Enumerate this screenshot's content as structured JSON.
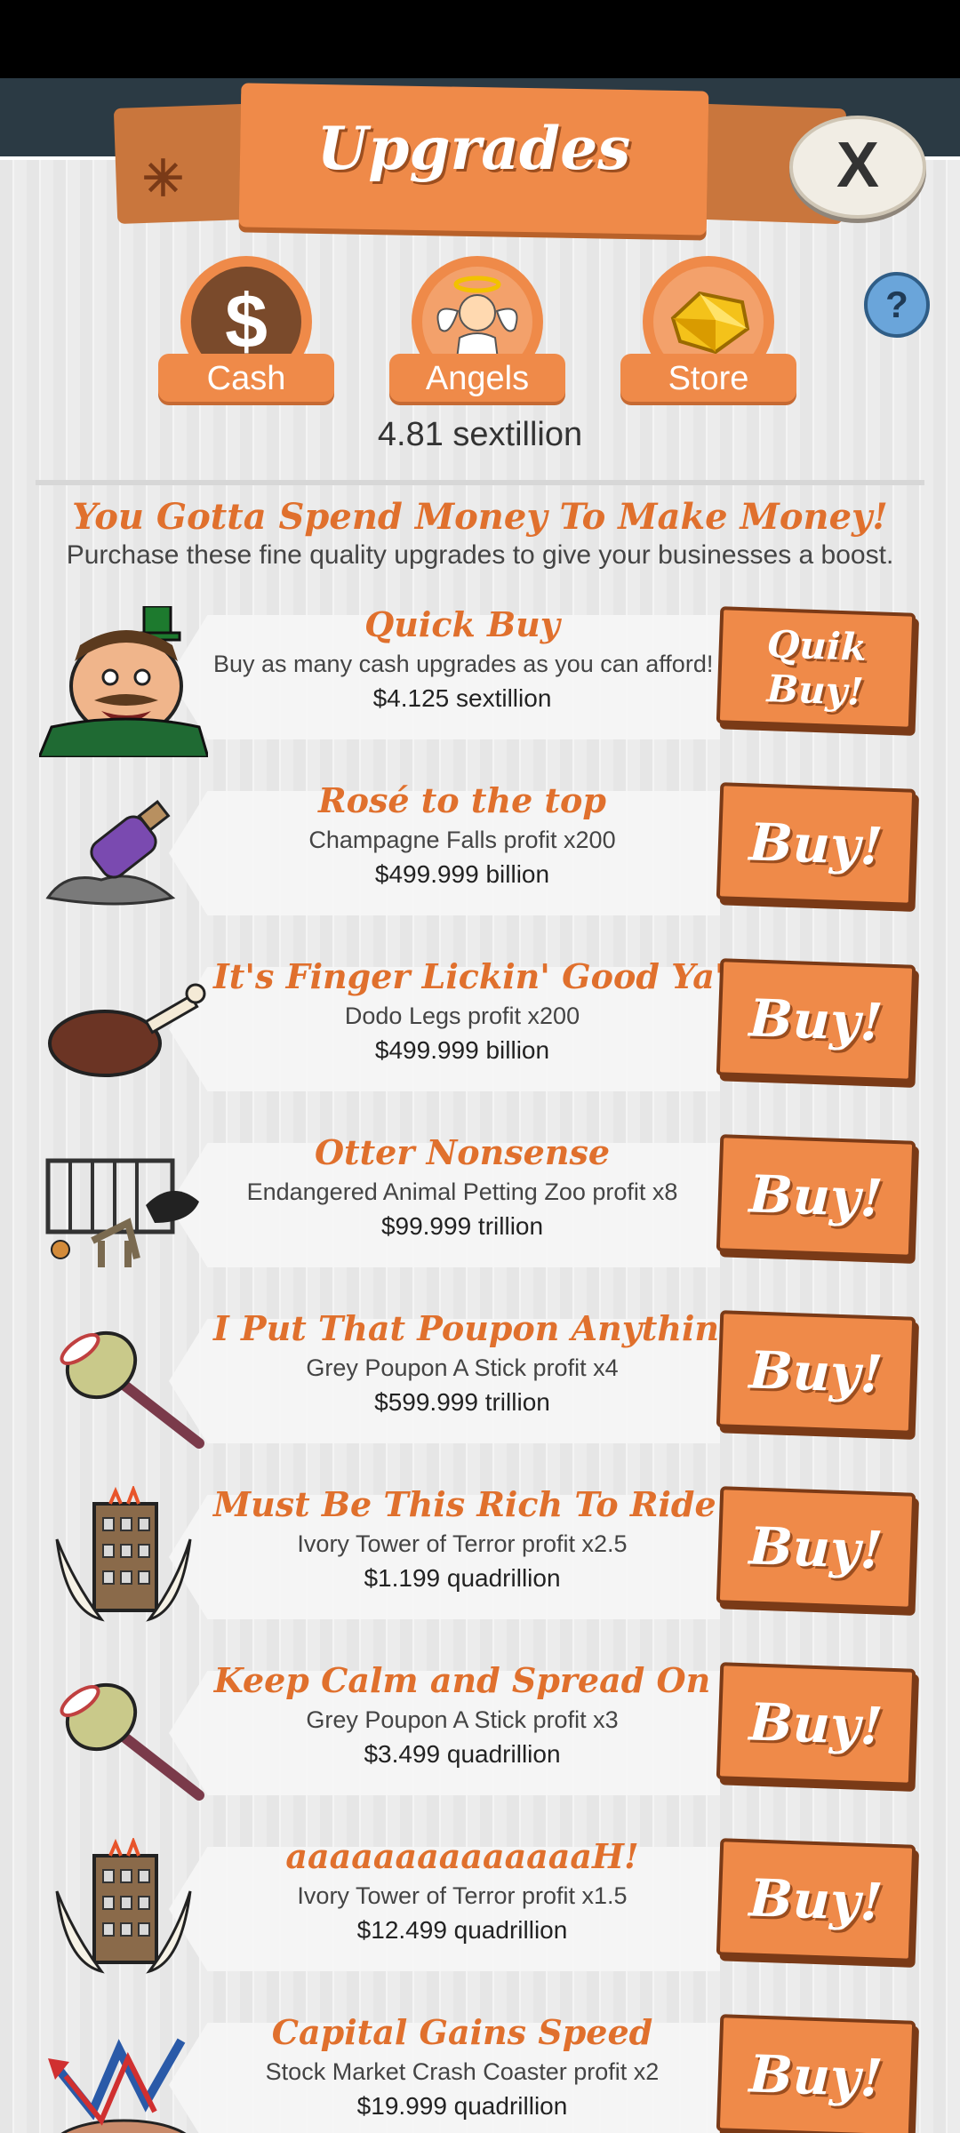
{
  "window": {
    "title": "Upgrades",
    "close_label": "X"
  },
  "tabs": [
    {
      "label": "Cash",
      "icon": "dollar-coin-icon"
    },
    {
      "label": "Angels",
      "icon": "angel-icon"
    },
    {
      "label": "Store",
      "icon": "gold-gem-icon"
    }
  ],
  "help_label": "?",
  "balance": "4.81 sextillion",
  "intro": {
    "headline": "You Gotta Spend Money To Make Money!",
    "subline": "Purchase these fine quality upgrades to give your businesses a boost."
  },
  "upgrades": [
    {
      "name": "Quick Buy",
      "desc": "Buy as many cash upgrades as you can afford!",
      "price": "$4.125 sextillion",
      "button": "Quik Buy!",
      "icon": "tycoon-icon"
    },
    {
      "name": "Rosé to the top",
      "desc": "Champagne Falls profit x200",
      "price": "$499.999 billion",
      "button": "Buy!",
      "icon": "bottle-icon"
    },
    {
      "name": "It's Finger Lickin' Good Ya'll",
      "desc": "Dodo Legs profit x200",
      "price": "$499.999 billion",
      "button": "Buy!",
      "icon": "drumstick-icon"
    },
    {
      "name": "Otter Nonsense",
      "desc": "Endangered Animal Petting Zoo profit x8",
      "price": "$99.999 trillion",
      "button": "Buy!",
      "icon": "zoo-cage-icon"
    },
    {
      "name": "I Put That Poupon Anything!",
      "desc": "Grey Poupon A Stick profit x4",
      "price": "$599.999 trillion",
      "button": "Buy!",
      "icon": "mustard-stick-icon"
    },
    {
      "name": "Must Be This Rich To Ride",
      "desc": "Ivory Tower of Terror profit x2.5",
      "price": "$1.199 quadrillion",
      "button": "Buy!",
      "icon": "ivory-tower-icon"
    },
    {
      "name": "Keep Calm and Spread On",
      "desc": "Grey Poupon A Stick profit x3",
      "price": "$3.499 quadrillion",
      "button": "Buy!",
      "icon": "mustard-stick-icon"
    },
    {
      "name": "aaaaaaaaaaaaaaH!",
      "desc": "Ivory Tower of Terror profit x1.5",
      "price": "$12.499 quadrillion",
      "button": "Buy!",
      "icon": "ivory-tower-icon"
    },
    {
      "name": "Capital Gains Speed",
      "desc": "Stock Market Crash Coaster profit x2",
      "price": "$19.999 quadrillion",
      "button": "Buy!",
      "icon": "coaster-icon"
    }
  ],
  "colors": {
    "accent": "#ef8a49",
    "accent_dark": "#7a3a17",
    "title_text": "#e0702d",
    "panel": "#ececec"
  }
}
